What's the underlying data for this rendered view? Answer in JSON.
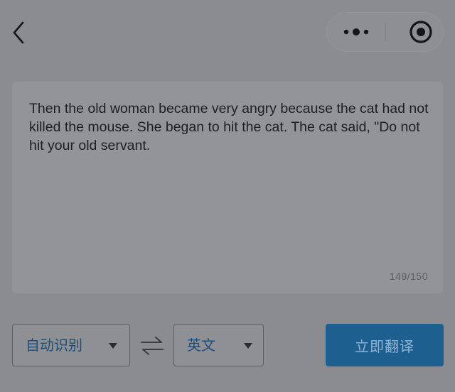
{
  "nav": {
    "back_icon": "chevron-left-icon",
    "more_icon": "more-dots-icon",
    "close_icon": "target-circle-icon"
  },
  "input": {
    "text": "Then the old woman became very angry because the cat had not killed the mouse. She began to hit the cat. The cat said, \"Do not hit your old servant.",
    "char_count": "149/150"
  },
  "languages": {
    "source_label": "自动识别",
    "swap_icon": "swap-arrows-icon",
    "target_label": "英文",
    "caret_icon": "caret-down-icon"
  },
  "actions": {
    "translate_label": "立即翻译"
  },
  "colors": {
    "overlay_background": "#8a8c90",
    "card_background": "#929498",
    "accent_text": "#1f4d7a",
    "primary_button": "#1d5f8e"
  }
}
